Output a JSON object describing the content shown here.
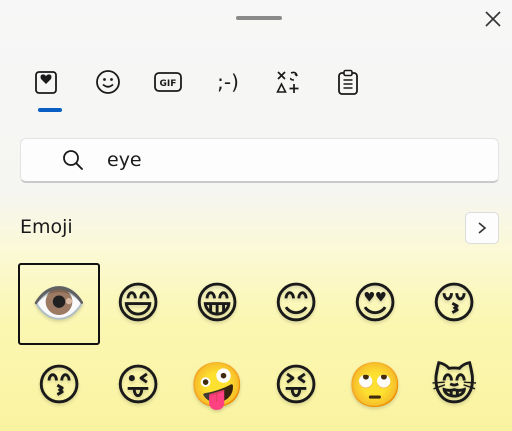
{
  "window": {
    "close_icon": "close-icon",
    "drag_handle": "drag-handle"
  },
  "tabs": [
    {
      "name": "favorites",
      "icon": "heart-clipboard-icon",
      "selected": true
    },
    {
      "name": "emoji",
      "icon": "smiley-icon",
      "selected": false
    },
    {
      "name": "gif",
      "label": "GIF",
      "icon": "gif-icon",
      "selected": false
    },
    {
      "name": "kaomoji",
      "label": ";-)",
      "icon": "kaomoji-icon",
      "selected": false
    },
    {
      "name": "symbols",
      "icon": "symbols-icon",
      "selected": false
    },
    {
      "name": "clipboard",
      "icon": "clipboard-icon",
      "selected": false
    }
  ],
  "accent_color": "#0a5fc4",
  "search": {
    "value": "eye",
    "placeholder": ""
  },
  "section": {
    "title": "Emoji",
    "next_icon": "chevron-right-icon"
  },
  "emoji_grid": [
    {
      "char": "👁️",
      "selected": true
    },
    {
      "char": "😄",
      "selected": false
    },
    {
      "char": "😁",
      "selected": false
    },
    {
      "char": "😊",
      "selected": false
    },
    {
      "char": "😍",
      "selected": false
    },
    {
      "char": "😚",
      "selected": false
    },
    {
      "char": "😙",
      "selected": false
    },
    {
      "char": "😜",
      "selected": false
    },
    {
      "char": "🤪",
      "selected": false
    },
    {
      "char": "😝",
      "selected": false
    },
    {
      "char": "🙄",
      "selected": false
    },
    {
      "char": "😸",
      "selected": false
    }
  ]
}
